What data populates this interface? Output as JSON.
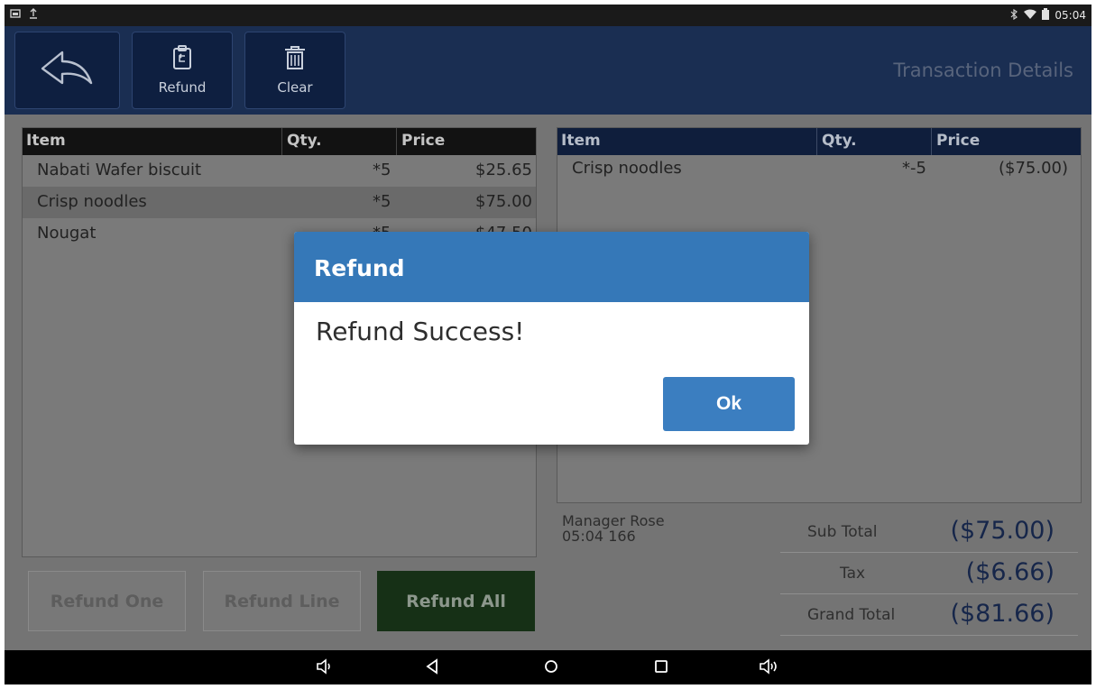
{
  "status_bar": {
    "time": "05:04"
  },
  "toolbar": {
    "back_icon": "back-arrow-icon",
    "refund_label": "Refund",
    "clear_label": "Clear",
    "title": "Transaction Details"
  },
  "original_items": {
    "headers": {
      "item": "Item",
      "qty": "Qty.",
      "price": "Price"
    },
    "rows": [
      {
        "name": "Nabati Wafer biscuit",
        "qty": "*5",
        "price": "$25.65",
        "struck": false
      },
      {
        "name": "Crisp noodles",
        "qty": "*5",
        "price": "$75.00",
        "struck": true
      },
      {
        "name": "Nougat",
        "qty": "*5",
        "price": "$47.50",
        "struck": false
      }
    ]
  },
  "refund_items": {
    "headers": {
      "item": "Item",
      "qty": "Qty.",
      "price": "Price"
    },
    "rows": [
      {
        "name": "Crisp noodles",
        "qty": "*-5",
        "price": "($75.00)"
      }
    ]
  },
  "cashier": {
    "name": "Manager Rose",
    "info": "05:04 166"
  },
  "totals": {
    "sub_total_label": "Sub Total",
    "sub_total": "($75.00)",
    "tax_label": "Tax",
    "tax": "($6.66)",
    "grand_total_label": "Grand Total",
    "grand_total": "($81.66)"
  },
  "actions": {
    "refund_one": "Refund One",
    "refund_line": "Refund Line",
    "refund_all": "Refund All"
  },
  "dialog": {
    "title": "Refund",
    "message": "Refund Success!",
    "ok_label": "Ok"
  },
  "colors": {
    "toolbar": "#1a2e52",
    "dialog_header": "#3578b8",
    "ok_button": "#3b7ec0",
    "refund_all_button": "#163016",
    "total_value": "#16264a"
  }
}
